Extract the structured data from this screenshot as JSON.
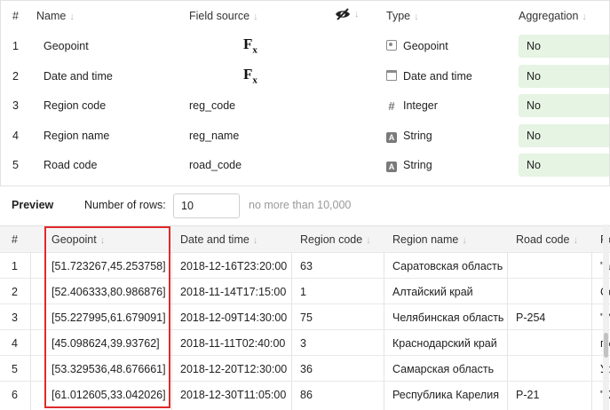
{
  "fields_table": {
    "headers": {
      "num": "#",
      "name": "Name",
      "source": "Field source",
      "type": "Type",
      "aggregation": "Aggregation"
    },
    "rows": [
      {
        "num": "1",
        "name": "Geopoint",
        "source": "",
        "formula": true,
        "type": "Geopoint",
        "type_icon": "geopoint-icon",
        "aggregation": "No"
      },
      {
        "num": "2",
        "name": "Date and time",
        "source": "",
        "formula": true,
        "type": "Date and time",
        "type_icon": "calendar-icon",
        "aggregation": "No"
      },
      {
        "num": "3",
        "name": "Region code",
        "source": "reg_code",
        "formula": false,
        "type": "Integer",
        "type_icon": "hash-icon",
        "aggregation": "No"
      },
      {
        "num": "4",
        "name": "Region name",
        "source": "reg_name",
        "formula": false,
        "type": "String",
        "type_icon": "string-icon",
        "aggregation": "No"
      },
      {
        "num": "5",
        "name": "Road code",
        "source": "road_code",
        "formula": false,
        "type": "String",
        "type_icon": "string-icon",
        "aggregation": "No"
      }
    ],
    "formula_glyph": "F",
    "formula_sub": "x"
  },
  "preview": {
    "title": "Preview",
    "rows_label": "Number of rows:",
    "rows_value": "10",
    "rows_hint": "no more than 10,000"
  },
  "preview_table": {
    "headers": [
      "#",
      "Geopoint",
      "Date and time",
      "Region code",
      "Region name",
      "Road code",
      "Ro"
    ],
    "rows": [
      [
        "1",
        "[51.723267,45.253758]",
        "2018-12-16T23:20:00",
        "63",
        "Саратовская область",
        "",
        "\"а"
      ],
      [
        "2",
        "[52.406333,80.986876]",
        "2018-11-14T17:15:00",
        "1",
        "Алтайский край",
        "",
        "Се"
      ],
      [
        "3",
        "[55.227995,61.679091]",
        "2018-12-09T14:30:00",
        "75",
        "Челябинская область",
        "Р-254",
        "\"И"
      ],
      [
        "4",
        "[45.098624,39.93762]",
        "2018-11-11T02:40:00",
        "3",
        "Краснодарский край",
        "",
        "г.У"
      ],
      [
        "5",
        "[53.329536,48.676661]",
        "2018-12-20T12:30:00",
        "36",
        "Самарская область",
        "",
        "Ур"
      ],
      [
        "6",
        "[61.012605,33.042026]",
        "2018-12-30T11:05:00",
        "86",
        "Республика Карелия",
        "Р-21",
        "\"К"
      ]
    ]
  },
  "colors": {
    "highlight": "#e0292b",
    "aggregation_bg": "#e6f4e3"
  }
}
